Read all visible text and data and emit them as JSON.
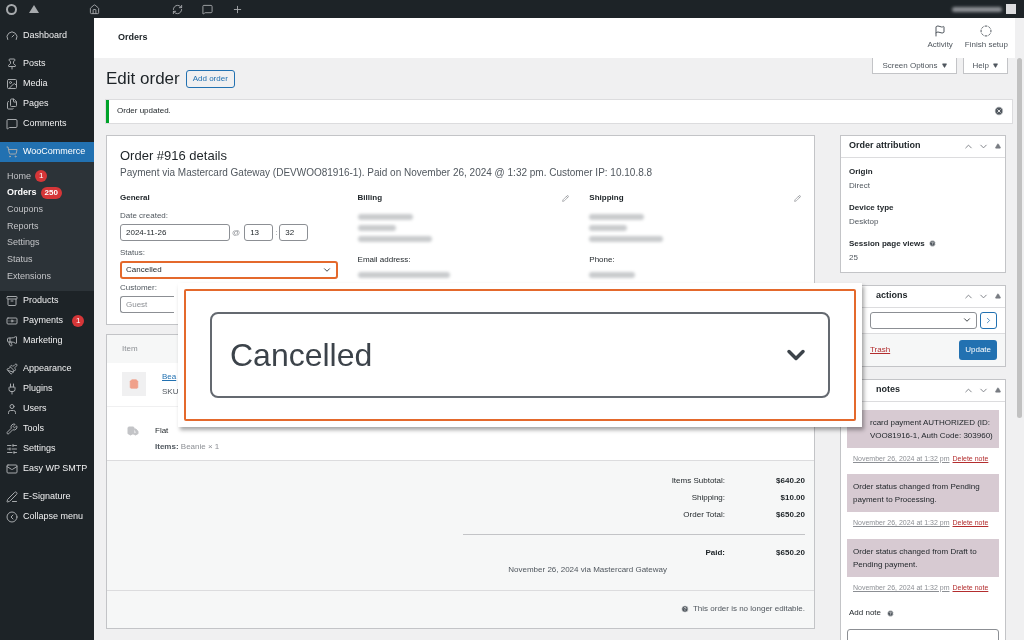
{
  "header": {
    "title": "Orders",
    "actions": [
      {
        "label": "Activity"
      },
      {
        "label": "Finish setup"
      }
    ]
  },
  "screen_tabs": [
    {
      "label": "Screen Options"
    },
    {
      "label": "Help"
    }
  ],
  "page": {
    "title": "Edit order",
    "add_button": "Add order"
  },
  "notice": {
    "text": "Order updated."
  },
  "sidebar": {
    "groups": [
      [
        {
          "label": "Dashboard",
          "selected": false
        }
      ],
      [
        {
          "label": "Posts",
          "selected": false
        },
        {
          "label": "Media",
          "selected": false
        },
        {
          "label": "Pages",
          "selected": false
        },
        {
          "label": "Comments",
          "selected": false
        }
      ],
      [
        {
          "label": "WooCommerce",
          "selected": true,
          "children": [
            {
              "label": "Home",
              "badge": "1",
              "selected": false
            },
            {
              "label": "Orders",
              "badge": "250",
              "selected": true
            },
            {
              "label": "Coupons",
              "selected": false
            },
            {
              "label": "Reports",
              "selected": false
            },
            {
              "label": "Settings",
              "selected": false
            },
            {
              "label": "Status",
              "selected": false
            },
            {
              "label": "Extensions",
              "selected": false
            }
          ]
        },
        {
          "label": "Products",
          "selected": false
        },
        {
          "label": "Payments",
          "badge": "1",
          "selected": false
        },
        {
          "label": "Marketing",
          "selected": false
        }
      ],
      [
        {
          "label": "Appearance",
          "selected": false
        },
        {
          "label": "Plugins",
          "selected": false
        },
        {
          "label": "Users",
          "selected": false
        },
        {
          "label": "Tools",
          "selected": false
        },
        {
          "label": "Settings",
          "selected": false
        },
        {
          "label": "Easy WP SMTP",
          "selected": false
        }
      ],
      [
        {
          "label": "E-Signature",
          "selected": false
        },
        {
          "label": "Collapse menu",
          "selected": false
        }
      ]
    ]
  },
  "order": {
    "title": "Order #916 details",
    "subtitle": "Payment via Mastercard Gateway (DEVWOO81916-1). Paid on November 26, 2024 @ 1:32 pm. Customer IP: 10.10.8.8",
    "general": {
      "heading": "General",
      "date_label": "Date created:",
      "date": "2024-11-26",
      "at": "@",
      "hour": "13",
      "colon": ":",
      "minute": "32",
      "status_label": "Status:",
      "status": "Cancelled",
      "customer_label": "Customer:",
      "customer_placeholder": "Guest"
    },
    "billing": {
      "heading": "Billing",
      "contact_label": "Email address:"
    },
    "shipping": {
      "heading": "Shipping",
      "contact_label": "Phone:"
    }
  },
  "items": {
    "column_1": "Item",
    "rows": [
      {
        "kind": "product",
        "name": "Bea",
        "meta": "SKU:"
      },
      {
        "kind": "shipping",
        "name": "Flat",
        "meta_label": "Items:",
        "meta": "Beanie × 1"
      }
    ],
    "totals": [
      {
        "label": "Items Subtotal:",
        "value": "$640.20"
      },
      {
        "label": "Shipping:",
        "value": "$10.00"
      },
      {
        "label": "Order Total:",
        "value": "$650.20"
      }
    ],
    "paid": {
      "label": "Paid:",
      "value": "$650.20",
      "note": "November 26, 2024 via Mastercard Gateway"
    },
    "footer": "This order is no longer editable."
  },
  "attribution": {
    "title": "Order attribution",
    "fields": [
      {
        "label": "Origin",
        "value": "Direct"
      },
      {
        "label": "Device type",
        "value": "Desktop"
      },
      {
        "label": "Session page views",
        "value": "25",
        "help": true
      }
    ]
  },
  "actions_box": {
    "title": "actions",
    "trash": "Trash",
    "update": "Update"
  },
  "notes_box": {
    "title": "notes",
    "notes": [
      {
        "lines": [
          "rcard payment AUTHORIZED (ID:",
          "VOO81916-1, Auth Code: 303960)"
        ],
        "date": "November 26, 2024 at 1:32 pm",
        "delete": "Delete note"
      },
      {
        "lines": [
          "Order status changed from Pending",
          "payment to Processing."
        ],
        "date": "November 26, 2024 at 1:32 pm",
        "delete": "Delete note"
      },
      {
        "lines": [
          "Order status changed from Draft to",
          "Pending payment."
        ],
        "date": "November 26, 2024 at 1:32 pm",
        "delete": "Delete note"
      }
    ],
    "add_label": "Add note"
  },
  "zoom": {
    "value": "Cancelled"
  }
}
